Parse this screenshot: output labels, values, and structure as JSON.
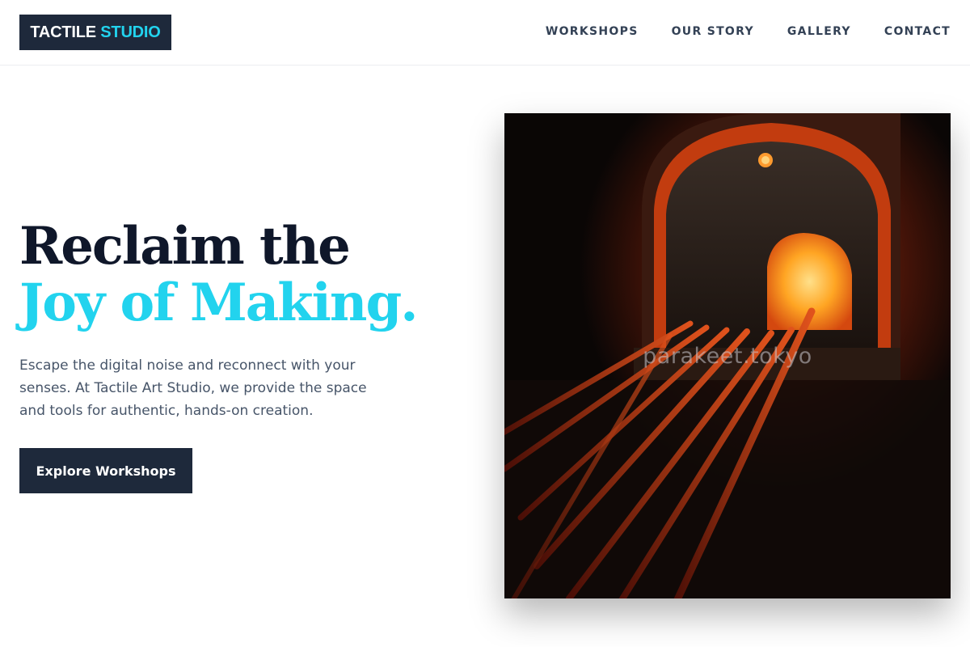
{
  "brand": {
    "name_part1": "TACTILE",
    "name_part2": "STUDIO"
  },
  "nav": {
    "items": [
      {
        "label": "WORKSHOPS"
      },
      {
        "label": "OUR STORY"
      },
      {
        "label": "GALLERY"
      },
      {
        "label": "CONTACT"
      }
    ]
  },
  "hero": {
    "title_line1": "Reclaim the",
    "title_line2": "Joy of Making.",
    "description": "Escape the digital noise and reconnect with your senses. At Tactile Art Studio, we provide the space and tools for authentic, hands-on creation.",
    "cta_label": "Explore Workshops"
  },
  "image": {
    "subject": "glass furnace with glowing rods",
    "watermark": "parakeet.tokyo"
  },
  "colors": {
    "primary_dark": "#1e293b",
    "accent_cyan": "#22d3ee",
    "heading": "#0f172a",
    "body_text": "#475569"
  }
}
